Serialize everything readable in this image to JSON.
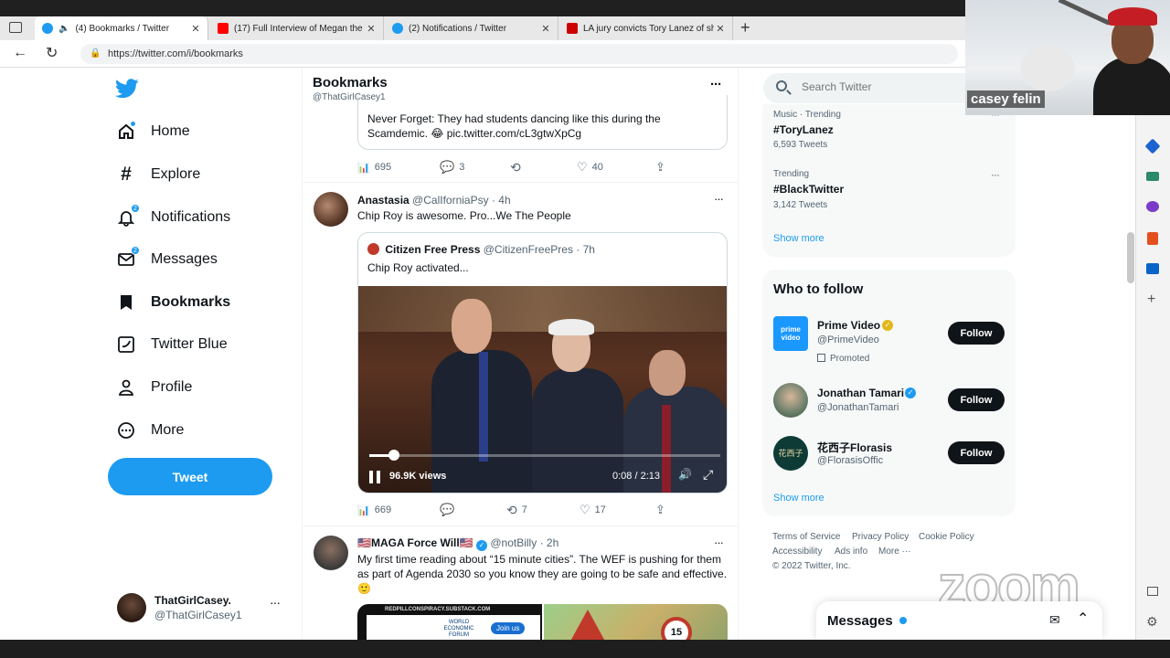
{
  "browser": {
    "tabs": [
      {
        "title": "(4) Bookmarks / Twitter",
        "favicon_color": "#1d9bf0",
        "active": true
      },
      {
        "title": "(17) Full Interview of Megan the",
        "favicon_color": "#ff0000",
        "active": false
      },
      {
        "title": "(2) Notifications / Twitter",
        "favicon_color": "#1d9bf0",
        "active": false
      },
      {
        "title": "LA jury convicts Tory Lanez of sh",
        "favicon_color": "#cc0000",
        "active": false
      }
    ],
    "url": "https://twitter.com/i/bookmarks"
  },
  "nav": {
    "items": [
      {
        "label": "Home",
        "icon": "home-icon"
      },
      {
        "label": "Explore",
        "icon": "hashtag-icon"
      },
      {
        "label": "Notifications",
        "icon": "bell-icon",
        "badge": "2"
      },
      {
        "label": "Messages",
        "icon": "envelope-icon",
        "badge": "2"
      },
      {
        "label": "Bookmarks",
        "icon": "bookmark-icon"
      },
      {
        "label": "Twitter Blue",
        "icon": "twitter-blue-icon"
      },
      {
        "label": "Profile",
        "icon": "person-icon"
      },
      {
        "label": "More",
        "icon": "more-circle-icon"
      }
    ],
    "tweet_button": "Tweet",
    "account": {
      "name": "ThatGirlCasey.",
      "handle": "@ThatGirlCasey1"
    }
  },
  "header": {
    "title": "Bookmarks",
    "handle": "@ThatGirlCasey1"
  },
  "tweets": {
    "t0": {
      "quote_text": "Never Forget: They had students dancing like this during the Scamdemic. 😂 pic.twitter.com/cL3gtwXpCg",
      "views": "695",
      "replies": "3",
      "retweets": "",
      "likes": "40"
    },
    "t1": {
      "name": "Anastasia",
      "handle": "@CalIforniaPsy",
      "time": "· 4h",
      "text": "Chip Roy is awesome. Pro...We The People",
      "quote": {
        "name": "Citizen Free Press",
        "handle": "@CitizenFreePres",
        "time": "· 7h",
        "text": "Chip Roy activated..."
      },
      "video": {
        "views": "96.9K views",
        "time": "0:08 / 2:13",
        "progress": 0.07
      },
      "views": "669",
      "replies": "",
      "retweets": "7",
      "likes": "17"
    },
    "t2": {
      "name": "🇺🇸MAGA Force Will🇺🇸",
      "handle": "@notBilly",
      "time": "· 2h",
      "text": "My first time reading about “15 minute cities”. The WEF is pushing for them as part of Agenda 2030 so you know they are going to be safe and effective.🙂",
      "img_caption": "REDPILLCONSPIRACY.SUBSTACK.COM",
      "img_org": "WORLD ECONOMIC FORUM",
      "img_join": "Join us",
      "sign_number": "15"
    }
  },
  "search": {
    "placeholder": "Search Twitter"
  },
  "trends": [
    {
      "context": "Music · Trending",
      "name": "#ToryLanez",
      "count": "6,593 Tweets"
    },
    {
      "context": "Trending",
      "name": "#BlackTwitter",
      "count": "3,142 Tweets"
    }
  ],
  "trends_show_more": "Show more",
  "who_to_follow": {
    "title": "Who to follow",
    "accounts": [
      {
        "name": "Prime Video",
        "handle": "@PrimeVideo",
        "promoted": "Promoted",
        "button": "Follow",
        "avatar_text": "prime video"
      },
      {
        "name": "Jonathan Tamari",
        "handle": "@JonathanTamari",
        "button": "Follow"
      },
      {
        "name": "花西子Florasis",
        "handle": "@FlorasisOffic",
        "button": "Follow",
        "avatar_text": "花西子"
      }
    ],
    "show_more": "Show more"
  },
  "footer": {
    "links": [
      "Terms of Service",
      "Privacy Policy",
      "Cookie Policy",
      "Accessibility",
      "Ads info",
      "More ···"
    ],
    "copyright": "© 2022 Twitter, Inc."
  },
  "messages_drawer": {
    "label": "Messages"
  },
  "zoom": {
    "participant": "casey felin",
    "watermark": "zoom"
  },
  "colors": {
    "accent": "#1d9bf0",
    "text": "#0f1419",
    "muted": "#536471"
  }
}
